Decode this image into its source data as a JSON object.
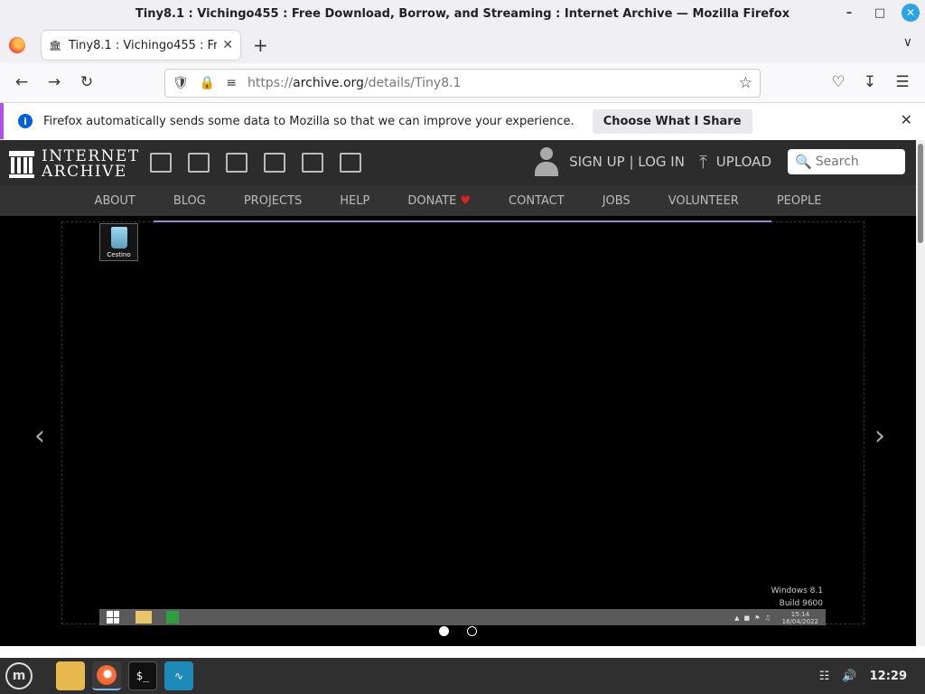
{
  "window": {
    "title": "Tiny8.1 : Vichingo455 : Free Download, Borrow, and Streaming : Internet Archive — Mozilla Firefox"
  },
  "tab": {
    "title": "Tiny8.1 : Vichingo455 : Free"
  },
  "address": {
    "scheme": "https://",
    "host": "archive.org",
    "path": "/details/Tiny8.1"
  },
  "notification": {
    "message": "Firefox automatically sends some data to Mozilla so that we can improve your experience.",
    "button": "Choose What I Share"
  },
  "ia": {
    "logo_line1": "INTERNET",
    "logo_line2": "ARCHIVE",
    "auth": "SIGN UP | LOG IN",
    "upload": "UPLOAD",
    "search_placeholder": "Search",
    "nav": [
      "ABOUT",
      "BLOG",
      "PROJECTS",
      "HELP",
      "DONATE",
      "CONTACT",
      "JOBS",
      "VOLUNTEER",
      "PEOPLE"
    ]
  },
  "emulator": {
    "desktop_icon_label": "Cestino",
    "version_line1": "Windows 8.1",
    "version_line2": "Build 9600",
    "time": "15:14",
    "date": "16/04/2022"
  },
  "taskbar": {
    "clock": "12:29"
  },
  "colors": {
    "accent": "#0060df",
    "ia_dark": "#2c2c2c",
    "donate_heart": "#e0221b"
  },
  "icons": [
    "firefox-icon",
    "archive-favicon",
    "shield-icon",
    "lock-icon",
    "star-icon",
    "pocket-icon",
    "download-icon",
    "menu-icon",
    "info-icon",
    "close-icon",
    "person-icon",
    "upload-icon",
    "search-icon",
    "recycle-bin-icon",
    "mint-menu-icon",
    "files-icon",
    "terminal-icon",
    "monitor-icon",
    "network-icon",
    "volume-icon"
  ]
}
